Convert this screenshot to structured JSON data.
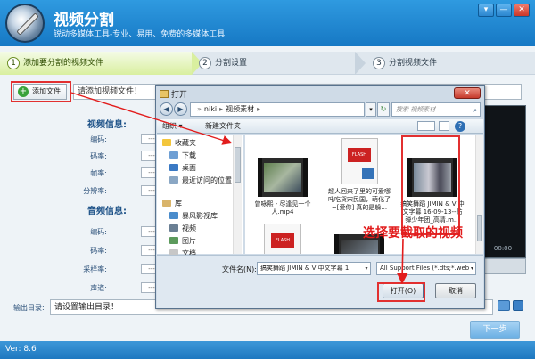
{
  "app": {
    "title": "视频分割",
    "subtitle": "锐动多媒体工具-专业、易用、免费的多媒体工具",
    "window_controls": [
      "▾",
      "—",
      "✕"
    ]
  },
  "steps": [
    {
      "num": "1",
      "label": "添加要分割的视频文件",
      "active": true
    },
    {
      "num": "2",
      "label": "分割设置",
      "active": false
    },
    {
      "num": "3",
      "label": "分割视频文件",
      "active": false
    }
  ],
  "toolbar": {
    "add_label": "添加文件",
    "path_placeholder": "请添加视频文件！"
  },
  "video_info": {
    "title": "视频信息:",
    "rows": [
      {
        "label": "编码:",
        "value": "---"
      },
      {
        "label": "码率:",
        "value": "---"
      },
      {
        "label": "帧率:",
        "value": "---"
      },
      {
        "label": "分辨率:",
        "value": "---"
      }
    ]
  },
  "audio_info": {
    "title": "音频信息:",
    "rows": [
      {
        "label": "编码:",
        "value": "---"
      },
      {
        "label": "码率:",
        "value": "---"
      },
      {
        "label": "采样率:",
        "value": "---"
      },
      {
        "label": "声道:",
        "value": "---"
      }
    ]
  },
  "preview": {
    "time": "00:00"
  },
  "output": {
    "label": "输出目录:",
    "placeholder": "请设置输出目录！"
  },
  "next_label": "下一步",
  "version": "Ver: 8.6",
  "dialog": {
    "title": "打开",
    "close": "✕",
    "breadcrumb": [
      "niki",
      "视频素材"
    ],
    "search_placeholder": "搜索 视频素材",
    "organize": "组织 ▾",
    "new_folder": "新建文件夹",
    "help": "?",
    "nav": [
      {
        "label": "收藏夹",
        "icon": "star-icon"
      },
      {
        "label": "下载",
        "icon": "download-folder-icon"
      },
      {
        "label": "桌面",
        "icon": "desktop-icon"
      },
      {
        "label": "最近访问的位置",
        "icon": "recent-icon"
      },
      {
        "label": "库",
        "icon": "library-icon"
      },
      {
        "label": "暴风影视库",
        "icon": "video-library-icon"
      },
      {
        "label": "视频",
        "icon": "video-folder-icon"
      },
      {
        "label": "图片",
        "icon": "picture-folder-icon"
      },
      {
        "label": "文档",
        "icon": "document-folder-icon"
      }
    ],
    "files": [
      {
        "name": "曾咏熙 - 尽逢见一个人.mp4",
        "type": "video"
      },
      {
        "name": "超人回来了里的可爱哪吒吃货宋民国，萌化了~[爱你] 真的是躲...",
        "type": "flash"
      },
      {
        "name": "搞笑舞蹈 JIMIN & V 中文字幕 16-09-13--防弹少年团_高清.m...",
        "type": "video",
        "selected": true
      },
      {
        "name": "",
        "type": "flash"
      },
      {
        "name": "",
        "type": "video"
      }
    ],
    "filename_label": "文件名(N):",
    "filename_value": "搞笑舞蹈 JIMIN & V 中文字幕 1",
    "filetype_value": "All Support Files (*.dts;*.web",
    "open_label": "打开(O)",
    "cancel_label": "取消"
  },
  "annotation": {
    "text": "选择要截取的视频",
    "color": "#e21c1c"
  },
  "colors": {
    "header": "#1f82cd",
    "highlight": "#e23030",
    "step_active": "#d9ef9f"
  }
}
